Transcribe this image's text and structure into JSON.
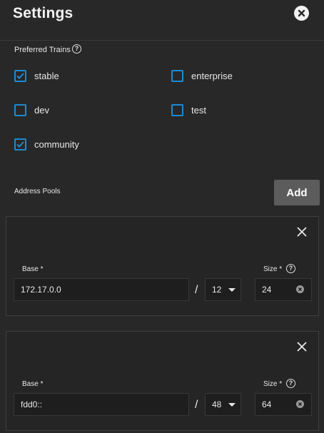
{
  "header": {
    "title": "Settings",
    "close_icon": "close-circle-icon"
  },
  "preferred_trains": {
    "label": "Preferred Trains",
    "options": [
      {
        "label": "stable",
        "checked": true
      },
      {
        "label": "enterprise",
        "checked": false
      },
      {
        "label": "dev",
        "checked": false
      },
      {
        "label": "test",
        "checked": false
      },
      {
        "label": "community",
        "checked": true
      }
    ]
  },
  "address_pools": {
    "label": "Address Pools",
    "add_label": "Add",
    "pools": [
      {
        "base_label": "Base *",
        "base_value": "172.17.0.0",
        "separator": "/",
        "prefix_value": "12",
        "size_label": "Size *",
        "size_value": "24"
      },
      {
        "base_label": "Base *",
        "base_value": "fdd0::",
        "separator": "/",
        "prefix_value": "48",
        "size_label": "Size *",
        "size_value": "64"
      }
    ]
  },
  "colors": {
    "accent": "#1e8ad1",
    "background": "#282828",
    "button": "#5c5c5c"
  }
}
